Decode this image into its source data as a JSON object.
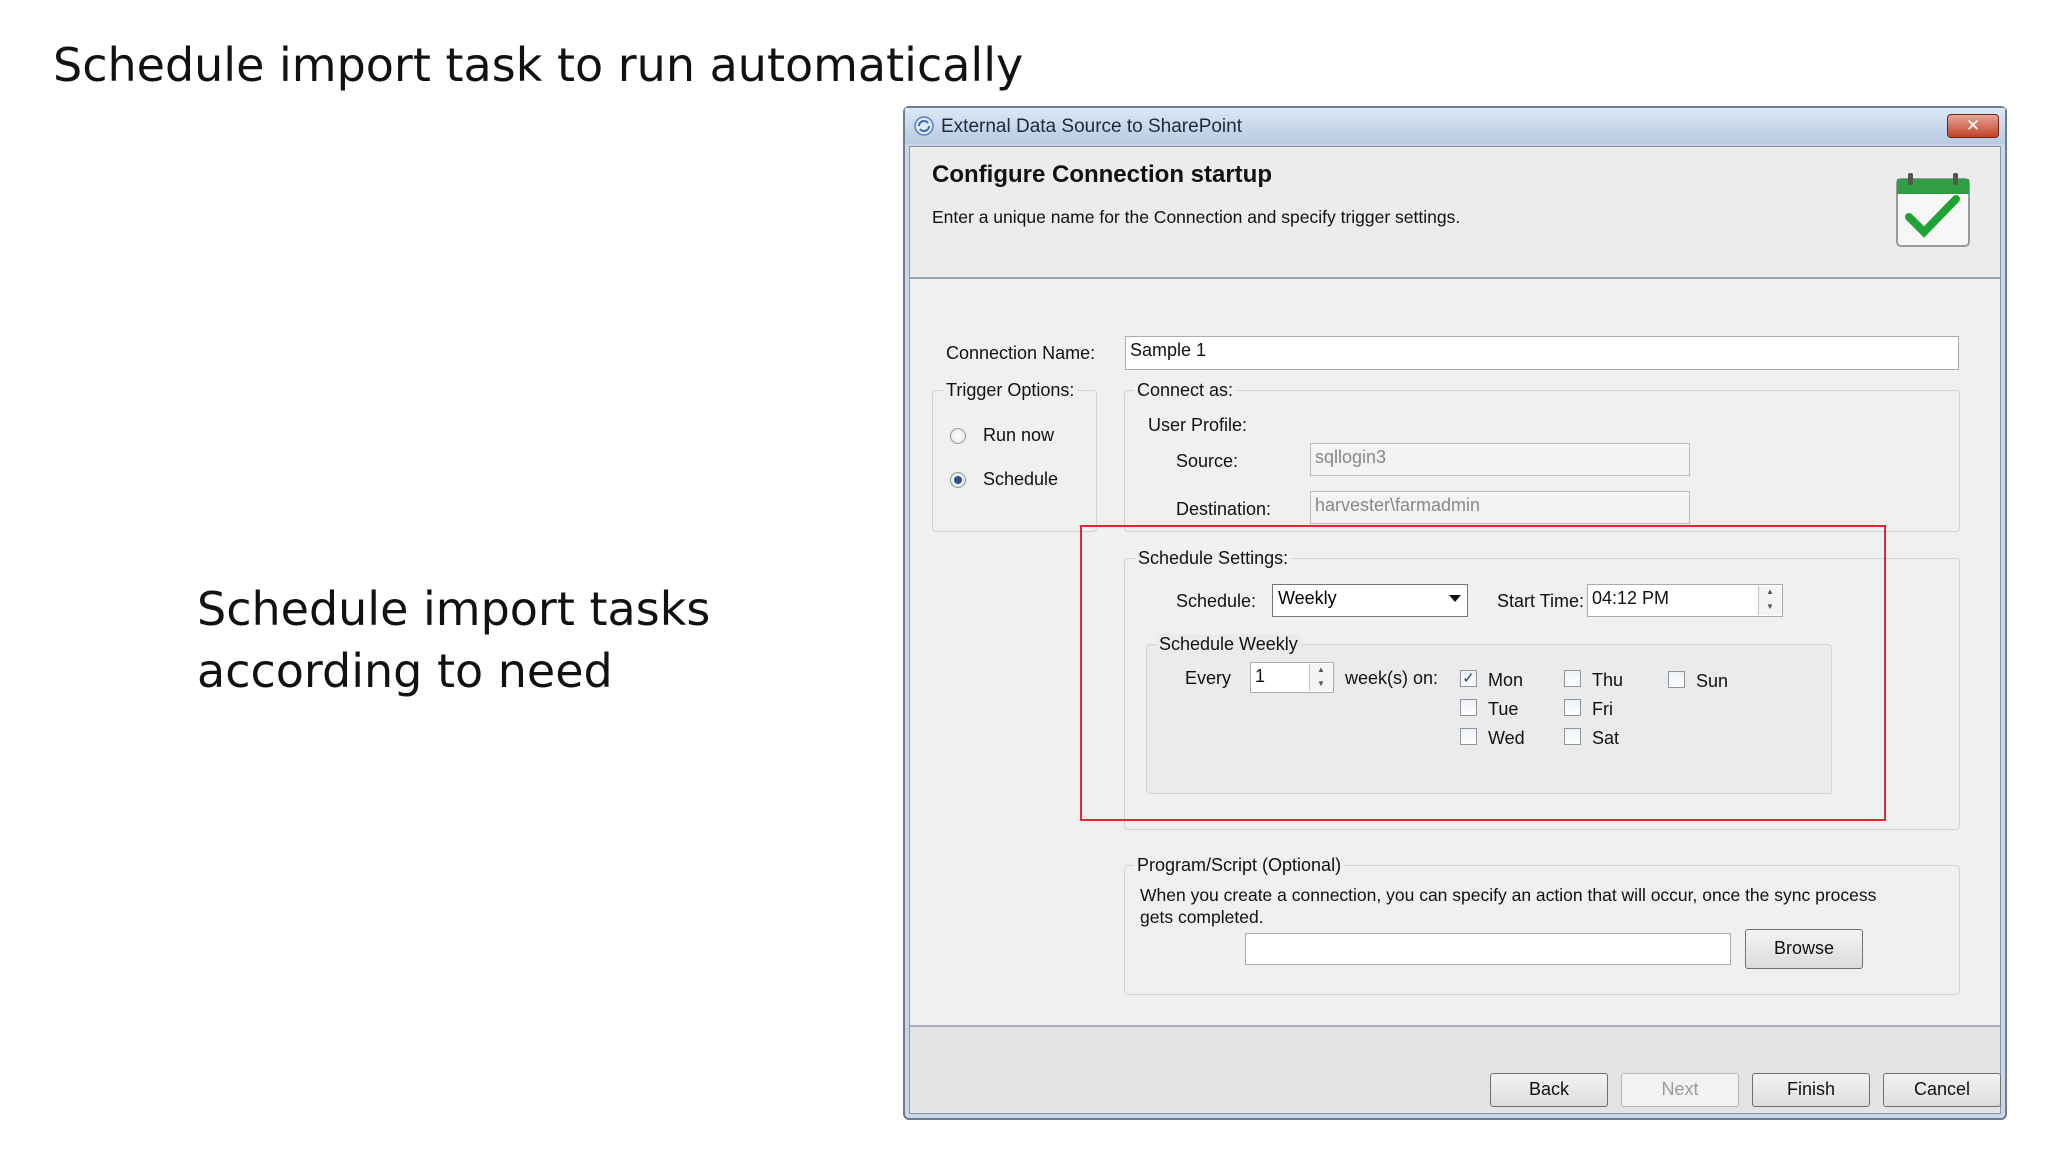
{
  "slide": {
    "title": "Schedule import task to run automatically",
    "caption_line1": "Schedule import tasks",
    "caption_line2": "according to need"
  },
  "dialog": {
    "window_title": "External Data Source to SharePoint",
    "close_label": "✕",
    "header_title": "Configure Connection startup",
    "header_description": "Enter a unique name for the Connection and specify trigger settings.",
    "connection_name_label": "Connection Name:",
    "connection_name_value": "Sample 1",
    "trigger_options": {
      "label": "Trigger Options:",
      "options": [
        "Run now",
        "Schedule"
      ],
      "selected": "Schedule"
    },
    "connect_as": {
      "label": "Connect as:",
      "user_profile_label": "User Profile:",
      "source_label": "Source:",
      "source_value": "sqllogin3",
      "destination_label": "Destination:",
      "destination_value": "harvester\\farmadmin"
    },
    "schedule_settings": {
      "label": "Schedule Settings:",
      "schedule_label": "Schedule:",
      "schedule_value": "Weekly",
      "start_time_label": "Start Time:",
      "start_time_value": "04:12 PM",
      "weekly": {
        "label": "Schedule Weekly",
        "every_label": "Every",
        "every_value": "1",
        "weeks_on_label": "week(s) on:",
        "days": [
          {
            "name": "Mon",
            "checked": true
          },
          {
            "name": "Tue",
            "checked": false
          },
          {
            "name": "Wed",
            "checked": false
          },
          {
            "name": "Thu",
            "checked": false
          },
          {
            "name": "Fri",
            "checked": false
          },
          {
            "name": "Sat",
            "checked": false
          },
          {
            "name": "Sun",
            "checked": false
          }
        ]
      }
    },
    "program_script": {
      "label": "Program/Script (Optional)",
      "description_line1": "When you create a connection, you can specify an action that will occur, once the sync process",
      "description_line2": "gets completed.",
      "path_value": "",
      "browse_label": "Browse"
    },
    "buttons": {
      "back": "Back",
      "next": "Next",
      "finish": "Finish",
      "cancel": "Cancel"
    }
  },
  "colors": {
    "highlight": "#e3272e",
    "check_green": "#1fa335"
  },
  "icons": {
    "app": "sync-icon",
    "header": "calendar-check-icon",
    "close": "close-icon"
  }
}
